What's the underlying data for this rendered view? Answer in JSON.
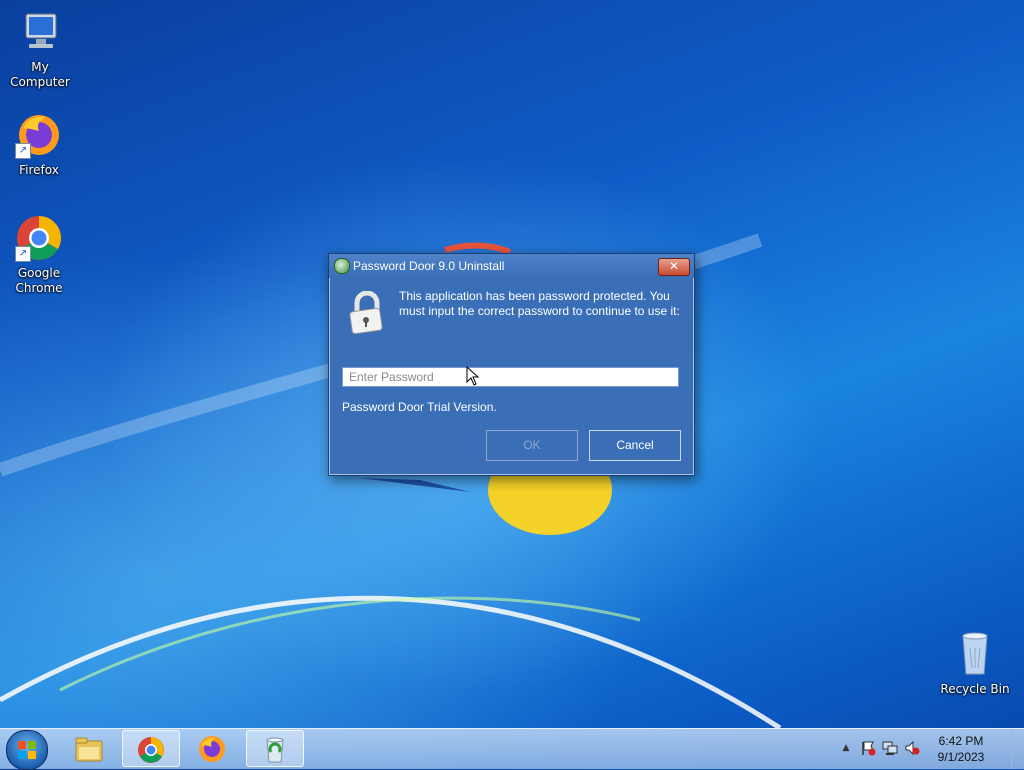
{
  "desktop": {
    "icons": [
      {
        "label": "My Computer",
        "icon": "computer-icon"
      },
      {
        "label": "Firefox",
        "icon": "firefox-icon"
      },
      {
        "label": "Google Chrome",
        "icon": "chrome-icon"
      },
      {
        "label": "Recycle Bin",
        "icon": "recycle-bin-icon"
      }
    ]
  },
  "dialog": {
    "title": "Password Door 9.0 Uninstall",
    "close_label": "✕",
    "message": "This application has been password protected. You must input the correct password to continue to use it:",
    "password_placeholder": "Enter Password",
    "password_value": "",
    "trial_text": "Password Door Trial Version.",
    "ok_label": "OK",
    "cancel_label": "Cancel",
    "ok_enabled": false
  },
  "taskbar": {
    "items": [
      {
        "icon": "windows-explorer-icon",
        "active": false
      },
      {
        "icon": "chrome-icon",
        "active": true
      },
      {
        "icon": "firefox-icon",
        "active": false
      },
      {
        "icon": "password-door-icon",
        "active": true
      }
    ],
    "tray": {
      "show_hidden_icon": "▲",
      "icons": [
        "action-center-icon",
        "network-icon",
        "volume-muted-icon"
      ]
    },
    "clock": {
      "time": "6:42 PM",
      "date": "9/1/2023"
    }
  },
  "colors": {
    "dialog_bg": "#3a6fb8",
    "close_button": "#c94a32"
  }
}
